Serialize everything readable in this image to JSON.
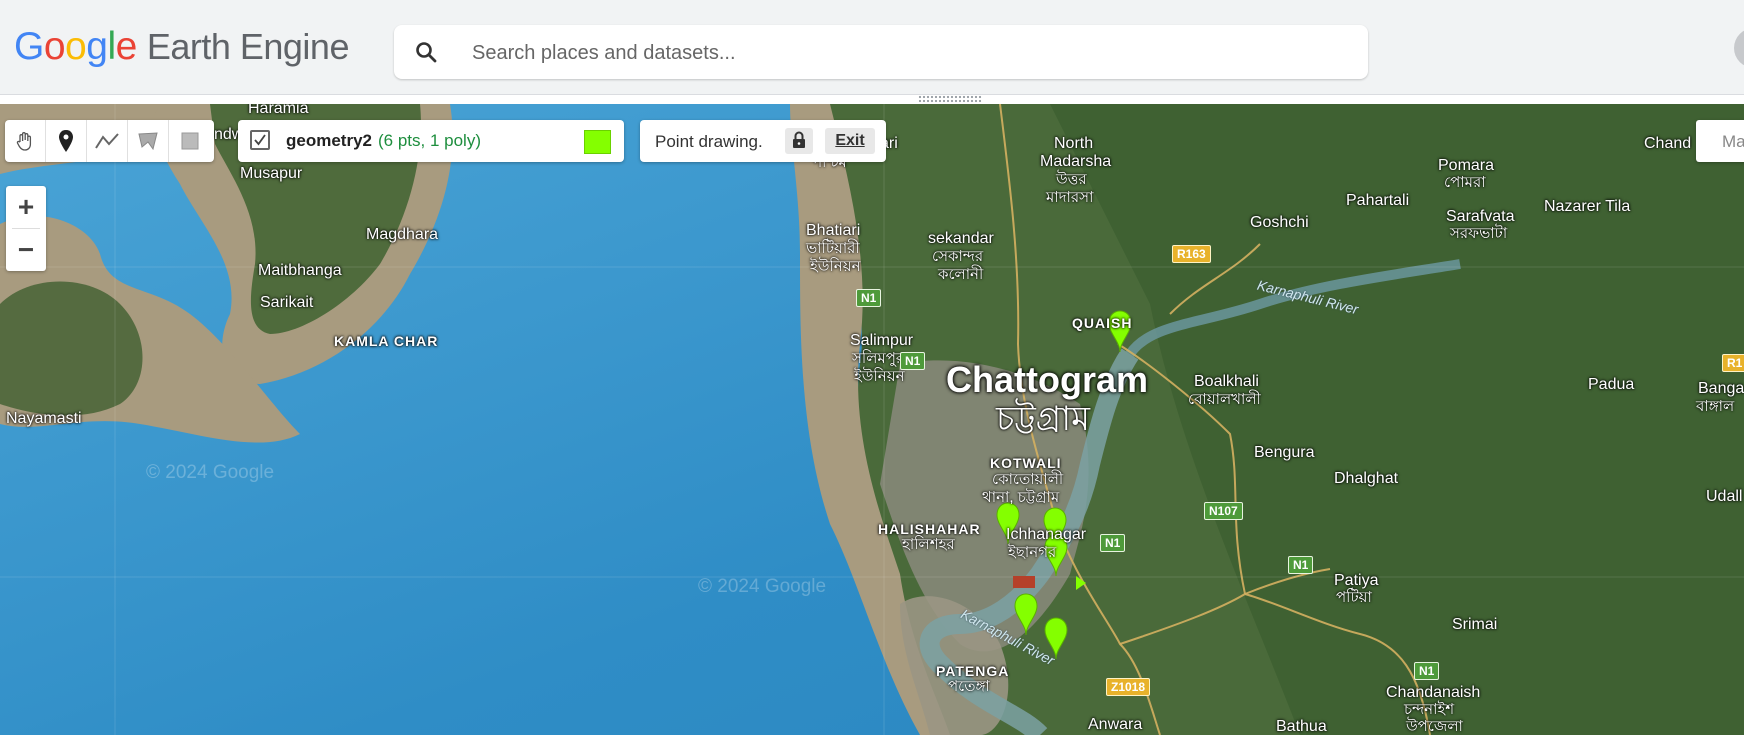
{
  "header": {
    "logo": {
      "google": [
        "G",
        "o",
        "o",
        "g",
        "l",
        "e"
      ],
      "product": "Earth Engine"
    },
    "search": {
      "placeholder": "Search places and datasets...",
      "icon": "search-icon"
    },
    "avatar_icon": "account-avatar-icon"
  },
  "drawing_tools": {
    "tools": [
      {
        "name": "pan-hand-icon",
        "label": "Pan"
      },
      {
        "name": "marker-icon",
        "label": "Add a marker"
      },
      {
        "name": "line-icon",
        "label": "Draw a line"
      },
      {
        "name": "polygon-icon",
        "label": "Draw a shape"
      },
      {
        "name": "rectangle-icon",
        "label": "Draw a rectangle"
      }
    ]
  },
  "geometry_layer": {
    "name": "geometry2",
    "count": "(6 pts, 1 poly)",
    "checked": true,
    "color": "#84ff00"
  },
  "drawing_mode": {
    "text": "Point drawing.",
    "lock_icon": "lock-icon",
    "exit_label": "Exit"
  },
  "zoom": {
    "in_label": "+",
    "out_label": "−"
  },
  "map_type_button": {
    "label": "Ma"
  },
  "map": {
    "place_labels": [
      {
        "text": "Haramia"
      },
      {
        "text": "ndw"
      },
      {
        "text": "Musapur"
      },
      {
        "text": "Magdhara"
      },
      {
        "text": "Maitbhanga"
      },
      {
        "text": "Sarikait"
      },
      {
        "text": "KAMLA CHAR"
      },
      {
        "text": "Nayamasti"
      },
      {
        "text": "ari"
      },
      {
        "text": "পশ্চিম"
      },
      {
        "text": "North"
      },
      {
        "text": "Madarsha"
      },
      {
        "text": "উত্তর"
      },
      {
        "text": "মাদারসা"
      },
      {
        "text": "Pomara"
      },
      {
        "text": "পোমরা"
      },
      {
        "text": "Pahartali"
      },
      {
        "text": "Goshchi"
      },
      {
        "text": "Sarafvata"
      },
      {
        "text": "সরফভাটা"
      },
      {
        "text": "Nazarer Tila"
      },
      {
        "text": "Chand"
      },
      {
        "text": "Bhatiari"
      },
      {
        "text": "ভাটিয়ারী"
      },
      {
        "text": "ইউনিয়ন"
      },
      {
        "text": "sekandar"
      },
      {
        "text": "সেকান্দর"
      },
      {
        "text": "কলোনী"
      },
      {
        "text": "QUAISH"
      },
      {
        "text": "Salimpur"
      },
      {
        "text": "সলিমপুর"
      },
      {
        "text": "ইউনিয়ন"
      },
      {
        "text": "Chattogram"
      },
      {
        "text": "চট্টগ্রাম"
      },
      {
        "text": "Boalkhali"
      },
      {
        "text": "বোয়ালখালী"
      },
      {
        "text": "Padua"
      },
      {
        "text": "Banga"
      },
      {
        "text": "বাঙ্গাল"
      },
      {
        "text": "KOTWALI"
      },
      {
        "text": "কোতোয়ালী"
      },
      {
        "text": "থানা, চট্টগ্রাম"
      },
      {
        "text": "Bengura"
      },
      {
        "text": "Dhalghat"
      },
      {
        "text": "Udall"
      },
      {
        "text": "HALISHAHAR"
      },
      {
        "text": "হালিশহর"
      },
      {
        "text": "Ichhanagar"
      },
      {
        "text": "ইছানগর"
      },
      {
        "text": "Patiya"
      },
      {
        "text": "পটিয়া"
      },
      {
        "text": "Srimai"
      },
      {
        "text": "PATENGA"
      },
      {
        "text": "পতেঙ্গা"
      },
      {
        "text": "Chandanaish"
      },
      {
        "text": "চন্দনাইশ"
      },
      {
        "text": "উপজেলা"
      },
      {
        "text": "Anwara"
      },
      {
        "text": "Bathua"
      }
    ],
    "rivers": [
      "Karnaphuli River",
      "Karnaphuli River"
    ],
    "roads": [
      "R163",
      "N1",
      "N1",
      "N1",
      "N1",
      "N107",
      "N1",
      "Z1018",
      "R1"
    ],
    "watermarks": [
      "© 2024 Google",
      "© 2024 Google"
    ],
    "marker_icon": "map-pin-icon",
    "polygon_color": "#b5402a"
  }
}
